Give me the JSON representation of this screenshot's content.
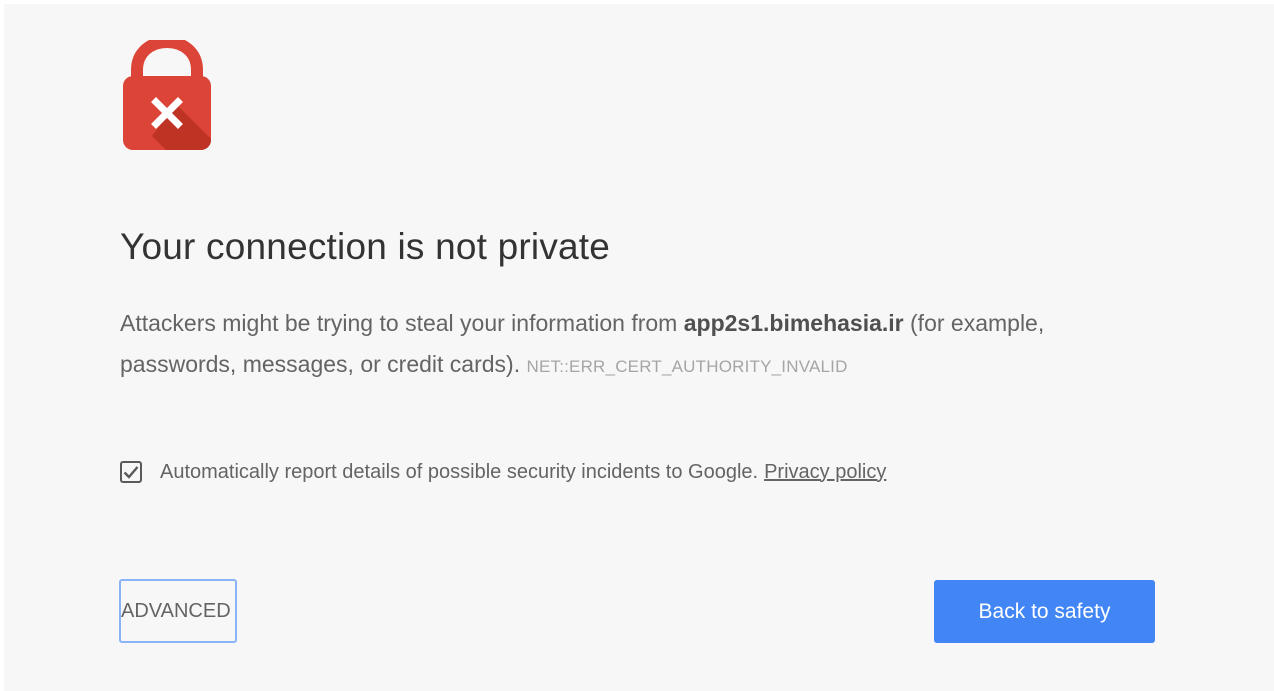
{
  "interstitial": {
    "heading": "Your connection is not private",
    "explanation_before_host": "Attackers might be trying to steal your information from ",
    "host": "app2s1.bimehasia.ir",
    "explanation_after_host": " (for example, passwords, messages, or credit cards). ",
    "error_code": "NET::ERR_CERT_AUTHORITY_INVALID",
    "report": {
      "checked": true,
      "label": "Automatically report details of possible security incidents to Google.",
      "privacy_link": "Privacy policy"
    },
    "advanced_button": "ADVANCED",
    "back_button": "Back to safety"
  },
  "icons": {
    "lock": "lock-error-icon",
    "checkmark": "checkmark-icon"
  },
  "colors": {
    "lock_red": "#db4437",
    "lock_shadow": "#a52714",
    "primary_button": "#4285f4",
    "focus_ring": "#8ab4f8",
    "background": "#f7f7f7"
  }
}
